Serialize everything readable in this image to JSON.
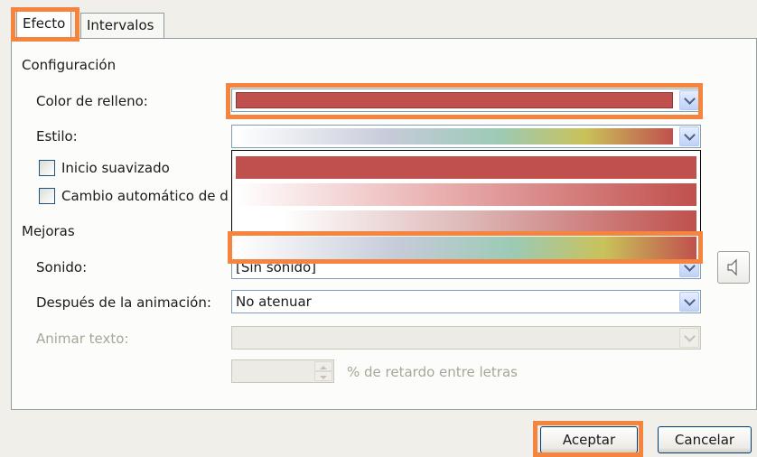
{
  "tabs": [
    {
      "label": "Efecto",
      "active": true
    },
    {
      "label": "Intervalos",
      "active": false
    }
  ],
  "configuracion": {
    "group_label": "Configuración",
    "color_relleno_label": "Color de relleno:",
    "estilo_label": "Estilo:",
    "inicio_suavizado_label": "Inicio suavizado",
    "cambio_automatico_label": "Cambio automático de d"
  },
  "style_options": [
    {
      "name": "solid"
    },
    {
      "name": "gradient-light-to-red"
    },
    {
      "name": "gradient-white-to-red"
    },
    {
      "name": "gradient-rainbow"
    }
  ],
  "mejoras": {
    "group_label": "Mejoras",
    "sonido_label": "Sonido:",
    "sonido_value": "[Sin sonido]",
    "despues_label": "Después de la animación:",
    "despues_value": "No atenuar",
    "animar_texto_label": "Animar texto:",
    "retardo_label": "% de retardo entre letras"
  },
  "buttons": {
    "aceptar": "Aceptar",
    "cancelar": "Cancelar"
  },
  "colors": {
    "fill_red": "#c0504d",
    "highlight": "#f5843e"
  },
  "icons": {
    "dropdown": "chevron-down-icon",
    "sound": "speaker-icon"
  }
}
